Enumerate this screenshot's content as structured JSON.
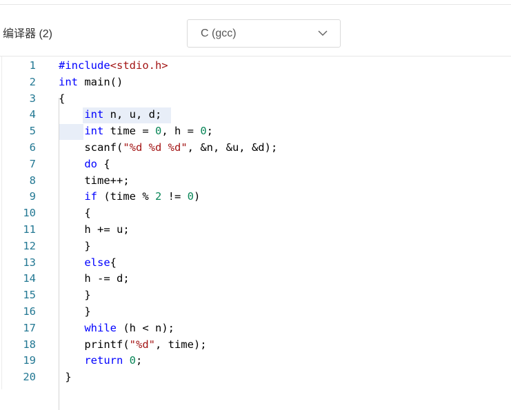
{
  "toolbar": {
    "compiler_label": "编译器 (2)",
    "compiler_select": {
      "selected": "C (gcc)"
    }
  },
  "editor": {
    "line_numbers": [
      "1",
      "2",
      "3",
      "4",
      "5",
      "6",
      "7",
      "8",
      "9",
      "10",
      "11",
      "12",
      "13",
      "14",
      "15",
      "16",
      "17",
      "18",
      "19",
      "20"
    ],
    "lines": [
      [
        {
          "t": "#include",
          "c": "kw"
        },
        {
          "t": "<stdio.h>",
          "c": "inc"
        }
      ],
      [
        {
          "t": "int",
          "c": "kw"
        },
        {
          "t": " main()",
          "c": ""
        }
      ],
      [
        {
          "t": "{",
          "c": ""
        }
      ],
      [
        {
          "t": "    ",
          "c": ""
        },
        {
          "t": "int",
          "c": "kw"
        },
        {
          "t": " n, u, d;",
          "c": ""
        }
      ],
      [
        {
          "t": "    ",
          "c": ""
        },
        {
          "t": "int",
          "c": "kw"
        },
        {
          "t": " time = ",
          "c": ""
        },
        {
          "t": "0",
          "c": "num"
        },
        {
          "t": ", h = ",
          "c": ""
        },
        {
          "t": "0",
          "c": "num"
        },
        {
          "t": ";",
          "c": ""
        }
      ],
      [
        {
          "t": "    scanf(",
          "c": ""
        },
        {
          "t": "\"%d %d %d\"",
          "c": "str"
        },
        {
          "t": ", &n, &u, &d);",
          "c": ""
        }
      ],
      [
        {
          "t": "    ",
          "c": ""
        },
        {
          "t": "do",
          "c": "kw"
        },
        {
          "t": " {",
          "c": ""
        }
      ],
      [
        {
          "t": "    time++;",
          "c": ""
        }
      ],
      [
        {
          "t": "    ",
          "c": ""
        },
        {
          "t": "if",
          "c": "kw"
        },
        {
          "t": " (time % ",
          "c": ""
        },
        {
          "t": "2",
          "c": "num"
        },
        {
          "t": " != ",
          "c": ""
        },
        {
          "t": "0",
          "c": "num"
        },
        {
          "t": ")",
          "c": ""
        }
      ],
      [
        {
          "t": "    {",
          "c": ""
        }
      ],
      [
        {
          "t": "    h += u;",
          "c": ""
        }
      ],
      [
        {
          "t": "    }",
          "c": ""
        }
      ],
      [
        {
          "t": "    ",
          "c": ""
        },
        {
          "t": "else",
          "c": "kw"
        },
        {
          "t": "{",
          "c": ""
        }
      ],
      [
        {
          "t": "    h -= d;",
          "c": ""
        }
      ],
      [
        {
          "t": "    }",
          "c": ""
        }
      ],
      [
        {
          "t": "    }",
          "c": ""
        }
      ],
      [
        {
          "t": "    ",
          "c": ""
        },
        {
          "t": "while",
          "c": "kw"
        },
        {
          "t": " (h < n);",
          "c": ""
        }
      ],
      [
        {
          "t": "    printf(",
          "c": ""
        },
        {
          "t": "\"%d\"",
          "c": "str"
        },
        {
          "t": ", time);",
          "c": ""
        }
      ],
      [
        {
          "t": "    ",
          "c": ""
        },
        {
          "t": "return",
          "c": "kw"
        },
        {
          "t": " ",
          "c": ""
        },
        {
          "t": "0",
          "c": "num"
        },
        {
          "t": ";",
          "c": ""
        }
      ],
      [
        {
          "t": " }",
          "c": ""
        }
      ]
    ]
  },
  "colors": {
    "keyword": "#0000ff",
    "string": "#a31515",
    "number": "#098658",
    "line_number": "#237893",
    "selection": "#e8eef8"
  },
  "icons": {
    "select_chevron": "chevron-down-icon"
  }
}
